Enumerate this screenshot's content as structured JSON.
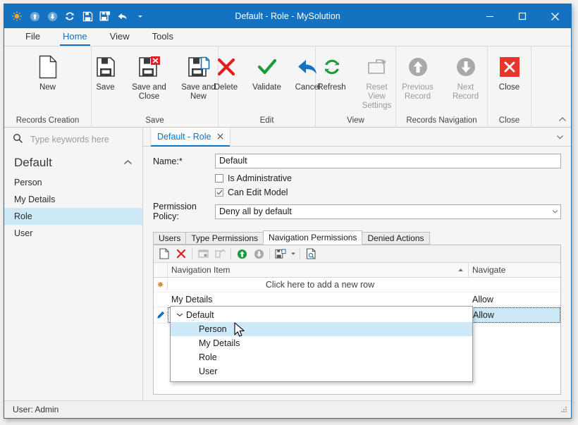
{
  "window": {
    "title": "Default - Role - MySolution",
    "minimize": "–",
    "maximize": "□",
    "close": "✕"
  },
  "quick_access": [
    {
      "name": "app-menu-icon",
      "label": "Application"
    },
    {
      "name": "previous-record-icon",
      "label": "Previous Record"
    },
    {
      "name": "next-record-icon",
      "label": "Next Record"
    },
    {
      "name": "refresh-icon",
      "label": "Refresh"
    },
    {
      "name": "save-icon",
      "label": "Save"
    },
    {
      "name": "save-and-close-icon",
      "label": "Save and Close"
    },
    {
      "name": "undo-icon",
      "label": "Undo"
    },
    {
      "name": "customize-qat-icon",
      "label": "Customize Quick Access Toolbar"
    }
  ],
  "ribbon_tabs": [
    {
      "label": "File",
      "active": false
    },
    {
      "label": "Home",
      "active": true
    },
    {
      "label": "View",
      "active": false
    },
    {
      "label": "Tools",
      "active": false
    }
  ],
  "ribbon_groups": [
    {
      "label": "Records Creation",
      "buttons": [
        {
          "label": "New",
          "icon": "new-document-icon",
          "disabled": false
        }
      ]
    },
    {
      "label": "Save",
      "buttons": [
        {
          "label": "Save",
          "icon": "save-icon",
          "disabled": false
        },
        {
          "label": "Save and Close",
          "icon": "save-and-close-icon",
          "disabled": false
        },
        {
          "label": "Save and New",
          "icon": "save-and-new-icon",
          "disabled": false
        }
      ]
    },
    {
      "label": "Edit",
      "buttons": [
        {
          "label": "Delete",
          "icon": "delete-icon",
          "disabled": false
        },
        {
          "label": "Validate",
          "icon": "validate-icon",
          "disabled": false
        },
        {
          "label": "Cancel",
          "icon": "cancel-icon",
          "disabled": false
        }
      ]
    },
    {
      "label": "View",
      "buttons": [
        {
          "label": "Refresh",
          "icon": "refresh-icon",
          "disabled": false
        },
        {
          "label": "Reset View Settings",
          "icon": "reset-view-settings-icon",
          "disabled": true
        }
      ]
    },
    {
      "label": "Records Navigation",
      "buttons": [
        {
          "label": "Previous Record",
          "icon": "previous-record-icon",
          "disabled": true
        },
        {
          "label": "Next Record",
          "icon": "next-record-icon",
          "disabled": true
        }
      ]
    },
    {
      "label": "Close",
      "buttons": [
        {
          "label": "Close",
          "icon": "close-icon",
          "disabled": false
        }
      ]
    }
  ],
  "ribbon_collapse_icon": "chevron-up-icon",
  "sidebar": {
    "search_placeholder": "Type keywords here",
    "search_value": "",
    "group_title": "Default",
    "group_collapse_icon": "chevron-up-icon",
    "items": [
      {
        "label": "Person",
        "selected": false
      },
      {
        "label": "My Details",
        "selected": false
      },
      {
        "label": "Role",
        "selected": true
      },
      {
        "label": "User",
        "selected": false
      }
    ]
  },
  "document_tab": {
    "label": "Default - Role",
    "close_icon": "close-icon",
    "menu_icon": "chevron-down-icon"
  },
  "form": {
    "name_label": "Name:*",
    "name_value": "Default",
    "is_administrative_label": "Is Administrative",
    "is_administrative_checked": false,
    "can_edit_model_label": "Can Edit Model",
    "can_edit_model_checked": true,
    "permission_policy_label": "Permission Policy:",
    "permission_policy_value": "Deny all by default"
  },
  "inner_tabs": [
    {
      "label": "Users",
      "active": false
    },
    {
      "label": "Type Permissions",
      "active": false
    },
    {
      "label": "Navigation Permissions",
      "active": true
    },
    {
      "label": "Denied Actions",
      "active": false
    }
  ],
  "grid_toolbar": [
    {
      "name": "new-record-icon",
      "label": "New",
      "disabled": false
    },
    {
      "name": "delete-record-icon",
      "label": "Delete",
      "disabled": false
    },
    {
      "name": "link-icon",
      "label": "Link",
      "disabled": true
    },
    {
      "name": "unlink-icon",
      "label": "Unlink",
      "disabled": true
    },
    {
      "name": "move-up-icon",
      "label": "Move Up",
      "disabled": false
    },
    {
      "name": "move-down-icon",
      "label": "Move Down",
      "disabled": true
    },
    {
      "name": "export-icon",
      "label": "Export",
      "disabled": false
    },
    {
      "name": "preview-icon",
      "label": "Print Preview",
      "disabled": false
    }
  ],
  "grid": {
    "columns": [
      {
        "label": "Navigation Item",
        "sort": "asc"
      },
      {
        "label": "Navigate",
        "sort": ""
      }
    ],
    "new_row_text": "Click here to add a new row",
    "new_row_indicator_icon": "new-row-star-icon",
    "rows": [
      {
        "navigation_item": "My Details",
        "navigate": "Allow",
        "editing": false
      },
      {
        "navigation_item": "Person",
        "navigate": "Allow",
        "editing": true
      }
    ],
    "edit_row_indicator_icon": "edit-pencil-icon",
    "editor_dropdown_icon": "chevron-down-icon"
  },
  "dropdown": {
    "group_label": "Default",
    "group_chevron_icon": "chevron-down-icon",
    "items": [
      {
        "label": "Person",
        "highlighted": true
      },
      {
        "label": "My Details",
        "highlighted": false
      },
      {
        "label": "Role",
        "highlighted": false
      },
      {
        "label": "User",
        "highlighted": false
      }
    ]
  },
  "statusbar": {
    "text": "User: Admin",
    "grip_icon": "resize-grip-icon"
  },
  "colors": {
    "titlebar": "#1572c0",
    "accent": "#1572c0",
    "selection": "#cde8f7",
    "delete_red": "#e02020",
    "validate_green": "#1d9b3c",
    "star_orange": "#f08a24"
  }
}
